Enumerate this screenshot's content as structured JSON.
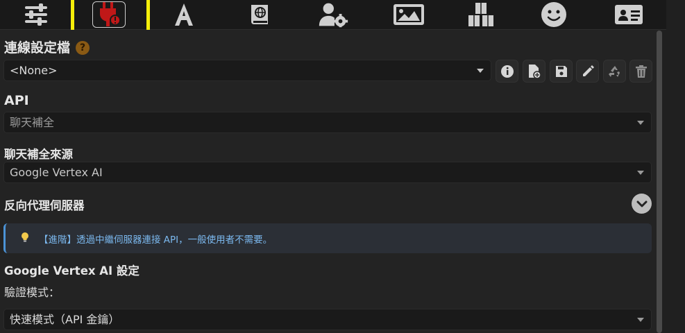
{
  "nav": {
    "icons": [
      "sliders-icon",
      "plug-icon",
      "font-icon",
      "book-globe-icon",
      "user-gear-icon",
      "image-icon",
      "cubes-icon",
      "smile-icon",
      "id-card-icon"
    ]
  },
  "connection": {
    "heading": "連線設定檔",
    "help": "?",
    "profile_value": "<None>",
    "toolbar_icons": [
      "info-icon",
      "new-file-icon",
      "save-icon",
      "pencil-icon",
      "recycle-icon",
      "trash-icon"
    ]
  },
  "api": {
    "heading": "API",
    "value": "聊天補全"
  },
  "source": {
    "heading": "聊天補全來源",
    "value": "Google Vertex AI"
  },
  "proxy": {
    "heading": "反向代理伺服器",
    "notice": "【進階】透過中繼伺服器連接 API，一般使用者不需要。"
  },
  "vertex": {
    "heading": "Google Vertex AI 設定",
    "auth_label": "驗證模式：",
    "auth_value": "快速模式（API 金鑰）"
  },
  "colors": {
    "accent_red": "#c01818",
    "highlight_yellow": "#f6ee0a",
    "notice_blue": "#7bb8ee"
  }
}
